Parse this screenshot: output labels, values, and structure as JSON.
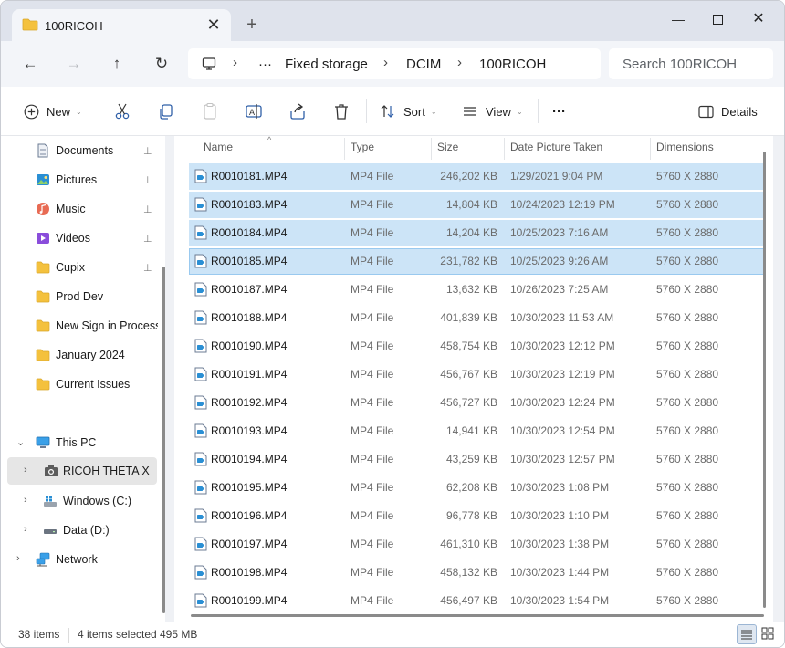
{
  "window": {
    "tab_title": "100RICOH",
    "tab_close": "✕",
    "new_tab": "+",
    "minimize": "—",
    "close": "✕"
  },
  "address": {
    "back": "←",
    "forward": "→",
    "up": "↑",
    "refresh": "↻",
    "ellipsis": "···",
    "crumbs": [
      "Fixed storage",
      "DCIM",
      "100RICOH"
    ],
    "separator": "›",
    "search_placeholder": "Search 100RICOH"
  },
  "toolbar": {
    "new_label": "New",
    "sort_label": "Sort",
    "view_label": "View",
    "more": "···",
    "details_label": "Details",
    "dropdown": "⌄"
  },
  "sidebar": {
    "quick_access": [
      {
        "label": "Documents",
        "icon": "documents-icon",
        "pinned": true
      },
      {
        "label": "Pictures",
        "icon": "pictures-icon",
        "pinned": true
      },
      {
        "label": "Music",
        "icon": "music-icon",
        "pinned": true
      },
      {
        "label": "Videos",
        "icon": "videos-icon",
        "pinned": true
      },
      {
        "label": "Cupix",
        "icon": "folder-icon",
        "pinned": true
      },
      {
        "label": "Prod Dev",
        "icon": "folder-icon",
        "pinned": false
      },
      {
        "label": "New Sign in Process l",
        "icon": "folder-icon",
        "pinned": false
      },
      {
        "label": "January 2024",
        "icon": "folder-icon",
        "pinned": false
      },
      {
        "label": "Current Issues",
        "icon": "folder-icon",
        "pinned": false
      }
    ],
    "pin_glyph": "📌",
    "this_pc": "This PC",
    "devices": [
      {
        "label": "RICOH THETA X",
        "icon": "camera-icon",
        "selected": true
      },
      {
        "label": "Windows (C:)",
        "icon": "drive-c-icon",
        "selected": false
      },
      {
        "label": "Data (D:)",
        "icon": "drive-d-icon",
        "selected": false
      }
    ],
    "network": "Network",
    "expand": "›",
    "collapse": "⌄"
  },
  "list": {
    "sort_caret": "^",
    "columns": {
      "name": "Name",
      "type": "Type",
      "size": "Size",
      "date": "Date Picture Taken",
      "dimensions": "Dimensions"
    },
    "rows": [
      {
        "name": "R0010181.MP4",
        "type": "MP4 File",
        "size": "246,202 KB",
        "date": "1/29/2021 9:04 PM",
        "dim": "5760 X 2880",
        "selected": true
      },
      {
        "name": "R0010183.MP4",
        "type": "MP4 File",
        "size": "14,804 KB",
        "date": "10/24/2023 12:19 PM",
        "dim": "5760 X 2880",
        "selected": true
      },
      {
        "name": "R0010184.MP4",
        "type": "MP4 File",
        "size": "14,204 KB",
        "date": "10/25/2023 7:16 AM",
        "dim": "5760 X 2880",
        "selected": true
      },
      {
        "name": "R0010185.MP4",
        "type": "MP4 File",
        "size": "231,782 KB",
        "date": "10/25/2023 9:26 AM",
        "dim": "5760 X 2880",
        "selected": true
      },
      {
        "name": "R0010187.MP4",
        "type": "MP4 File",
        "size": "13,632 KB",
        "date": "10/26/2023 7:25 AM",
        "dim": "5760 X 2880",
        "selected": false
      },
      {
        "name": "R0010188.MP4",
        "type": "MP4 File",
        "size": "401,839 KB",
        "date": "10/30/2023 11:53 AM",
        "dim": "5760 X 2880",
        "selected": false
      },
      {
        "name": "R0010190.MP4",
        "type": "MP4 File",
        "size": "458,754 KB",
        "date": "10/30/2023 12:12 PM",
        "dim": "5760 X 2880",
        "selected": false
      },
      {
        "name": "R0010191.MP4",
        "type": "MP4 File",
        "size": "456,767 KB",
        "date": "10/30/2023 12:19 PM",
        "dim": "5760 X 2880",
        "selected": false
      },
      {
        "name": "R0010192.MP4",
        "type": "MP4 File",
        "size": "456,727 KB",
        "date": "10/30/2023 12:24 PM",
        "dim": "5760 X 2880",
        "selected": false
      },
      {
        "name": "R0010193.MP4",
        "type": "MP4 File",
        "size": "14,941 KB",
        "date": "10/30/2023 12:54 PM",
        "dim": "5760 X 2880",
        "selected": false
      },
      {
        "name": "R0010194.MP4",
        "type": "MP4 File",
        "size": "43,259 KB",
        "date": "10/30/2023 12:57 PM",
        "dim": "5760 X 2880",
        "selected": false
      },
      {
        "name": "R0010195.MP4",
        "type": "MP4 File",
        "size": "62,208 KB",
        "date": "10/30/2023 1:08 PM",
        "dim": "5760 X 2880",
        "selected": false
      },
      {
        "name": "R0010196.MP4",
        "type": "MP4 File",
        "size": "96,778 KB",
        "date": "10/30/2023 1:10 PM",
        "dim": "5760 X 2880",
        "selected": false
      },
      {
        "name": "R0010197.MP4",
        "type": "MP4 File",
        "size": "461,310 KB",
        "date": "10/30/2023 1:38 PM",
        "dim": "5760 X 2880",
        "selected": false
      },
      {
        "name": "R0010198.MP4",
        "type": "MP4 File",
        "size": "458,132 KB",
        "date": "10/30/2023 1:44 PM",
        "dim": "5760 X 2880",
        "selected": false
      },
      {
        "name": "R0010199.MP4",
        "type": "MP4 File",
        "size": "456,497 KB",
        "date": "10/30/2023 1:54 PM",
        "dim": "5760 X 2880",
        "selected": false
      }
    ]
  },
  "status": {
    "item_count": "38 items",
    "selected": "4 items selected",
    "selected_size": "495 MB"
  },
  "colors": {
    "selection": "#cce4f7",
    "folder": "#f4c13d",
    "accent": "#0067c0"
  }
}
